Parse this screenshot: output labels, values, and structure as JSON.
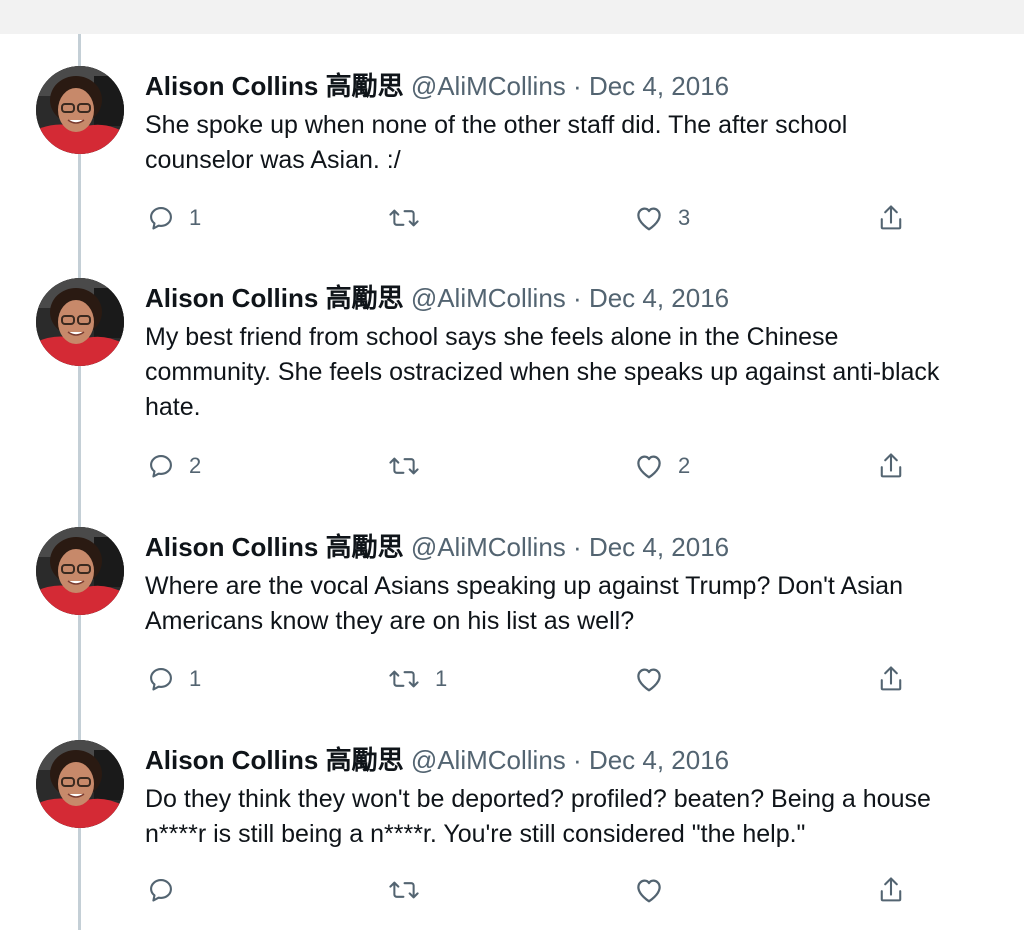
{
  "thread": {
    "tweets": [
      {
        "name": "Alison Collins 高勵思",
        "handle": "@AliMCollins",
        "separator": "·",
        "date": "Dec 4, 2016",
        "lines": [
          "She spoke up when none of the other staff did. The after school",
          "counselor was Asian. :/"
        ],
        "replies": "1",
        "retweets": "",
        "likes": "3"
      },
      {
        "name": "Alison Collins 高勵思",
        "handle": "@AliMCollins",
        "separator": "·",
        "date": "Dec 4, 2016",
        "lines": [
          "My best friend from school says she feels alone in the Chinese",
          "community. She feels ostracized when she speaks up against anti-black",
          "hate."
        ],
        "replies": "2",
        "retweets": "",
        "likes": "2"
      },
      {
        "name": "Alison Collins 高勵思",
        "handle": "@AliMCollins",
        "separator": "·",
        "date": "Dec 4, 2016",
        "lines": [
          "Where are the vocal Asians speaking up against Trump? Don't Asian",
          "Americans know they are on his list as well?"
        ],
        "replies": "1",
        "retweets": "1",
        "likes": ""
      },
      {
        "name": "Alison Collins 高勵思",
        "handle": "@AliMCollins",
        "separator": "·",
        "date": "Dec 4, 2016",
        "lines": [
          "Do they think they won't be deported? profiled? beaten? Being a house",
          "n****r is still being a n****r. You're still considered \"the help.\""
        ],
        "replies": "",
        "retweets": "",
        "likes": ""
      }
    ]
  },
  "icons": {
    "reply": "reply-icon",
    "retweet": "retweet-icon",
    "like": "heart-icon",
    "share": "share-icon"
  },
  "colors": {
    "text": "#0f1419",
    "secondary": "#536471",
    "thread_line": "#c4cfd6",
    "top_bar": "#f2f2f2"
  }
}
